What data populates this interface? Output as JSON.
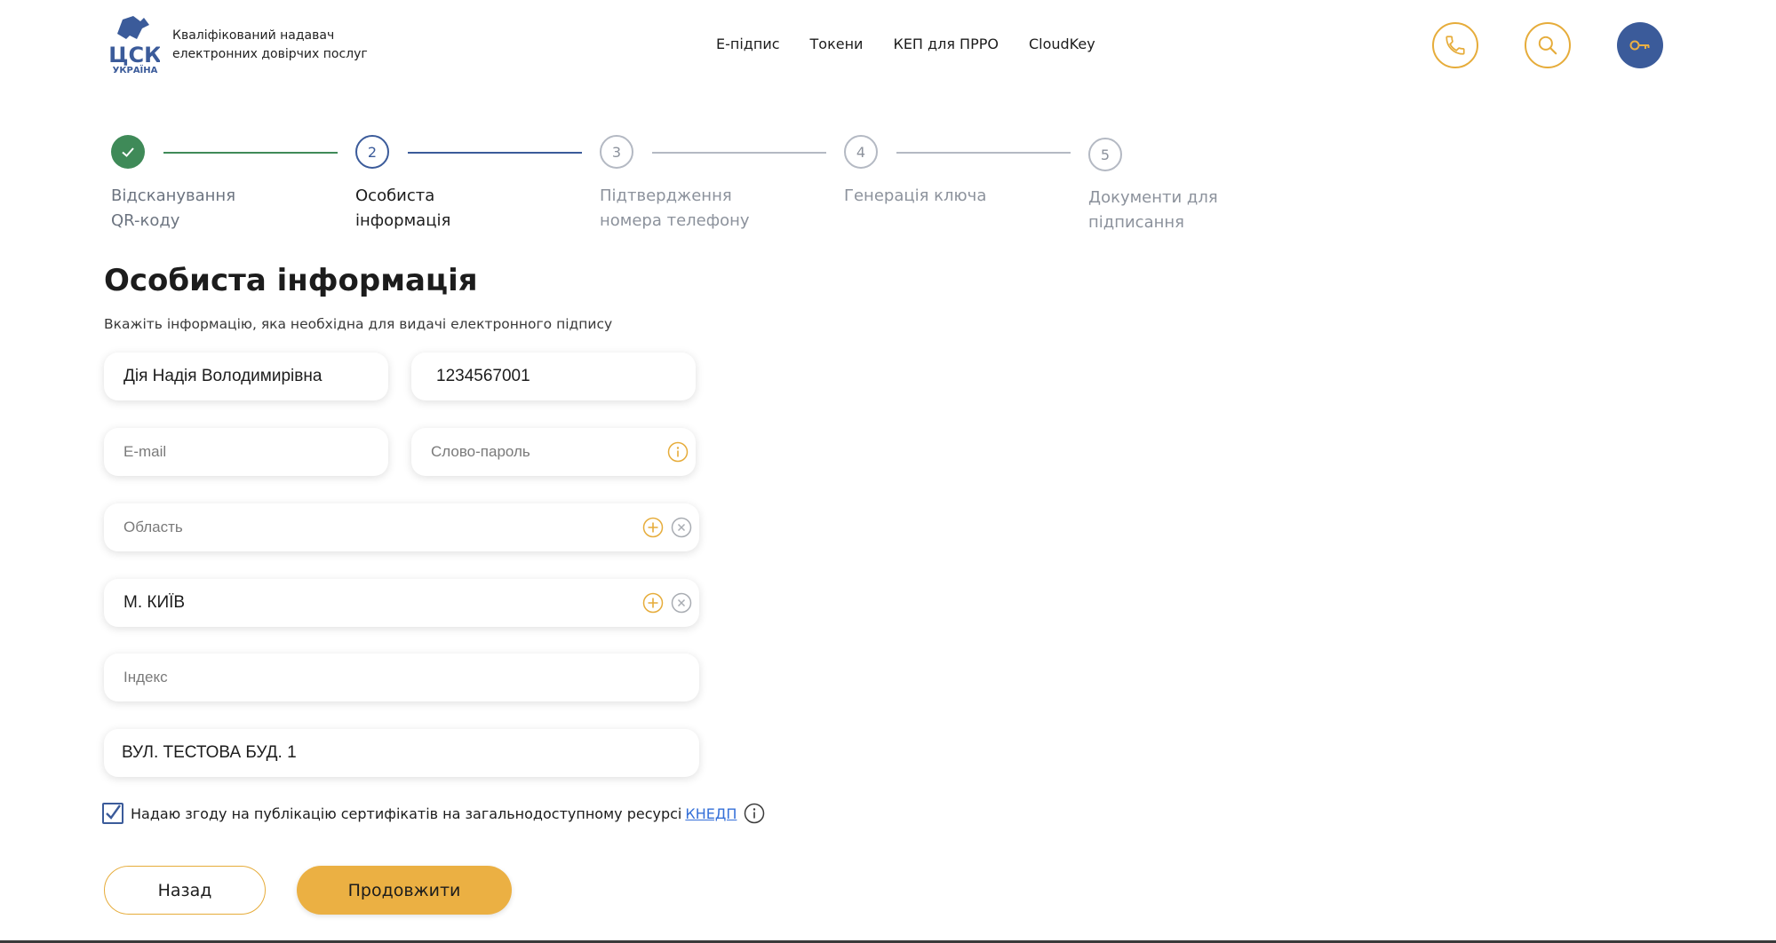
{
  "header": {
    "logo_main": "ЦСК",
    "logo_sub": "УКРАЇНА",
    "brand_line1": "Кваліфікований надавач",
    "brand_line2": "електронних довірчих послуг",
    "nav": [
      "Е-підпис",
      "Токени",
      "КЕП для ПРРО",
      "CloudKey"
    ],
    "buttons": {
      "phone_icon": "phone-icon",
      "search_icon": "search-icon",
      "key_icon": "key-icon"
    }
  },
  "stepper": {
    "steps": [
      {
        "number": "",
        "line1": "Відсканування",
        "line2": "QR-коду",
        "state": "done"
      },
      {
        "number": "2",
        "line1": "Особиста",
        "line2": "інформація",
        "state": "active"
      },
      {
        "number": "3",
        "line1": "Підтвердження",
        "line2": "номера телефону",
        "state": "pending"
      },
      {
        "number": "4",
        "line1": "Генерація ключа",
        "line2": "",
        "state": "pending"
      },
      {
        "number": "5",
        "line1": "Документи для",
        "line2": "підписання",
        "state": "pending"
      }
    ]
  },
  "form": {
    "title": "Особиста інформація",
    "description": "Вкажіть інформацію, яка необхідна для видачі електронного підпису",
    "full_name": {
      "value": "Дія Надія Володимирівна",
      "placeholder": ""
    },
    "tax_id": {
      "value": "1234567001",
      "placeholder": ""
    },
    "email": {
      "value": "",
      "placeholder": "E-mail"
    },
    "password_word": {
      "value": "",
      "placeholder": "Слово-пароль"
    },
    "region": {
      "value": "",
      "placeholder": "Область"
    },
    "city": {
      "value": "М. КИЇВ",
      "placeholder": ""
    },
    "postal_index": {
      "value": "",
      "placeholder": "Індекс"
    },
    "address": {
      "value": "ВУЛ. ТЕСТОВА БУД. 1",
      "placeholder": ""
    },
    "consent_text": "Надаю згоду на публікацію сертифікатів на загальнодоступному ресурсі",
    "consent_link": "КНЕДП",
    "consent_checked": true
  },
  "actions": {
    "back_label": "Назад",
    "next_label": "Продовжити"
  },
  "colors": {
    "accent": "#ebb043",
    "primary_blue": "#3b5b9a",
    "done_green": "#3f8a58",
    "link": "#3570d8"
  }
}
